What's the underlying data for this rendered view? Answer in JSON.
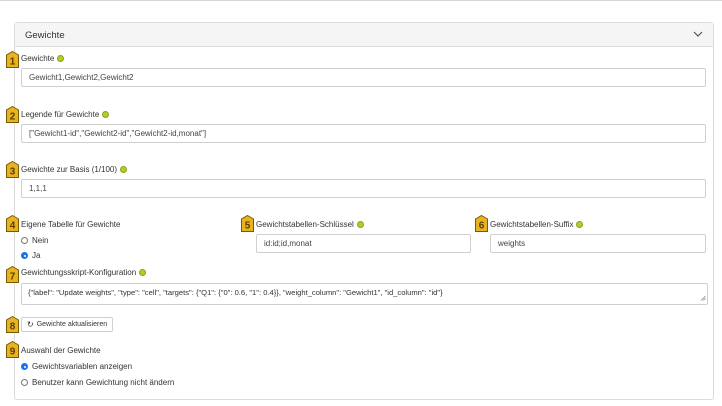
{
  "panel": {
    "title": "Gewichte"
  },
  "badges": [
    "1",
    "2",
    "3",
    "4",
    "5",
    "6",
    "7",
    "8",
    "9"
  ],
  "fields": {
    "gewichte": {
      "label": "Gewichte",
      "value": "Gewicht1,Gewicht2,Gewicht2"
    },
    "legende": {
      "label": "Legende für Gewichte",
      "value": "[\"Gewicht1-id\",\"Gewicht2-id\",\"Gewicht2-id,monat\"]"
    },
    "basis": {
      "label": "Gewichte zur Basis (1/100)",
      "value": "1,1,1"
    },
    "eigene_tabelle": {
      "label": "Eigene Tabelle für Gewichte",
      "options": [
        "Nein",
        "Ja"
      ],
      "selected": "Ja"
    },
    "schluessel": {
      "label": "Gewichtstabellen-Schlüssel",
      "value": "id:id;id,monat"
    },
    "suffix": {
      "label": "Gewichtstabellen-Suffix",
      "value": "weights"
    },
    "skript": {
      "label": "Gewichtungsskript-Konfiguration",
      "value": "{\"label\": \"Update weights\", \"type\": \"cell\", \"targets\": {\"Q1\": {\"0\": 0.6, \"1\": 0.4}}, \"weight_column\": \"Gewicht1\", \"id_column\": \"id\"}"
    },
    "update_button": {
      "label": "Gewichte aktualisieren",
      "icon": "refresh-icon"
    },
    "auswahl": {
      "label": "Auswahl der Gewichte",
      "options": [
        "Gewichtsvariablen anzeigen",
        "Benutzer kann Gewichtung nicht ändern"
      ],
      "selected": "Gewichtsvariablen anzeigen"
    }
  },
  "colors": {
    "badge_fill": "#e8b321",
    "badge_stroke": "#7a5a00",
    "help_dot": "#b4cc2a",
    "radio_selected": "#1a73e8"
  }
}
